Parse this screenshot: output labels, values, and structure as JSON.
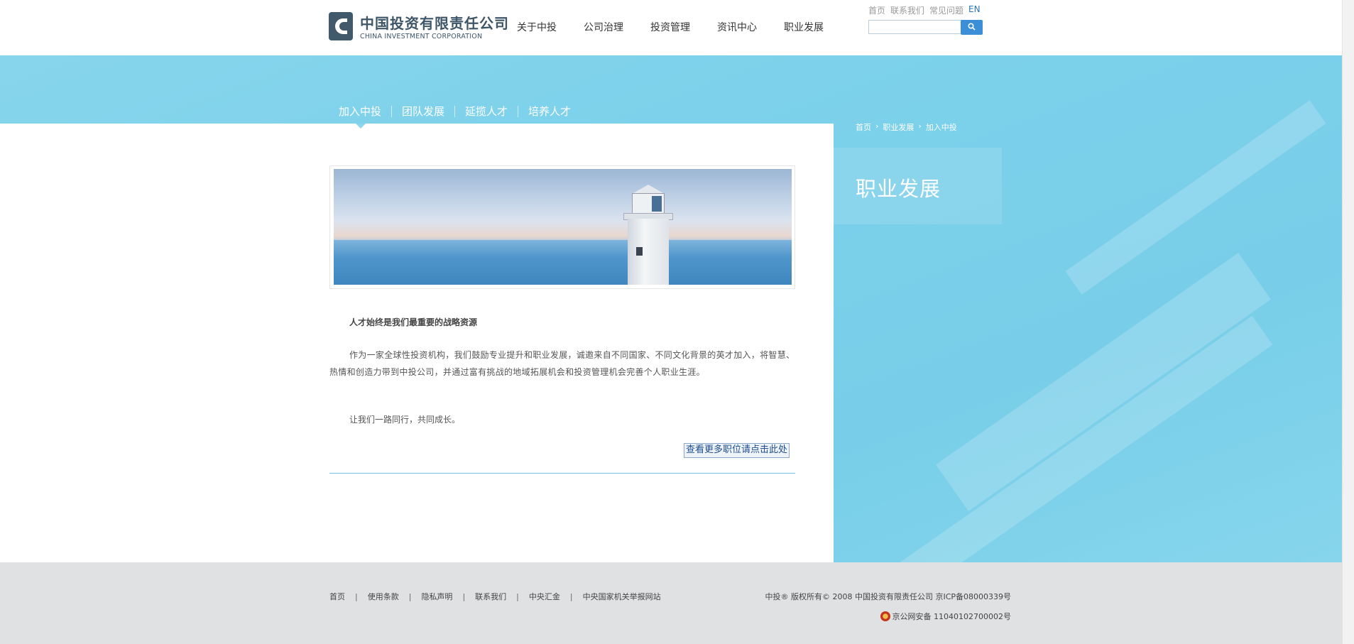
{
  "header": {
    "logo_cn": "中国投资有限责任公司",
    "logo_en": "CHINA INVESTMENT CORPORATION",
    "nav": [
      "关于中投",
      "公司治理",
      "投资管理",
      "资讯中心",
      "职业发展"
    ],
    "util_links": [
      "首页",
      "联系我们",
      "常见问题",
      "EN"
    ],
    "search_placeholder": "",
    "search_button_icon": "search-icon"
  },
  "sub_nav": [
    "加入中投",
    "团队发展",
    "延揽人才",
    "培养人才"
  ],
  "breadcrumb": [
    "首页",
    "职业发展",
    "加入中投"
  ],
  "sidebar": {
    "title": "职业发展"
  },
  "content": {
    "headline": "人才始终是我们最重要的战略资源",
    "body": "作为一家全球性投资机构，我们鼓励专业提升和职业发展，诚邀来自不同国家、不同文化背景的英才加入，将智慧、热情和创造力带到中投公司，并通过富有挑战的地域拓展机会和投资管理机会完善个人职业生涯。",
    "closing": "让我们一路同行，共同成长。",
    "more_jobs": "查看更多职位请点击此处"
  },
  "footer": {
    "links": [
      "首页",
      "使用条款",
      "隐私声明",
      "联系我们",
      "中央汇金",
      "中央国家机关举报网站"
    ],
    "copyright": "中投® 版权所有© 2008 中国投资有限责任公司 京ICP备08000339号",
    "police": "京公网安备 11040102700002号"
  },
  "colors": {
    "accent": "#7bd0ea",
    "brand": "#3e5668",
    "link": "#2a73b8"
  }
}
